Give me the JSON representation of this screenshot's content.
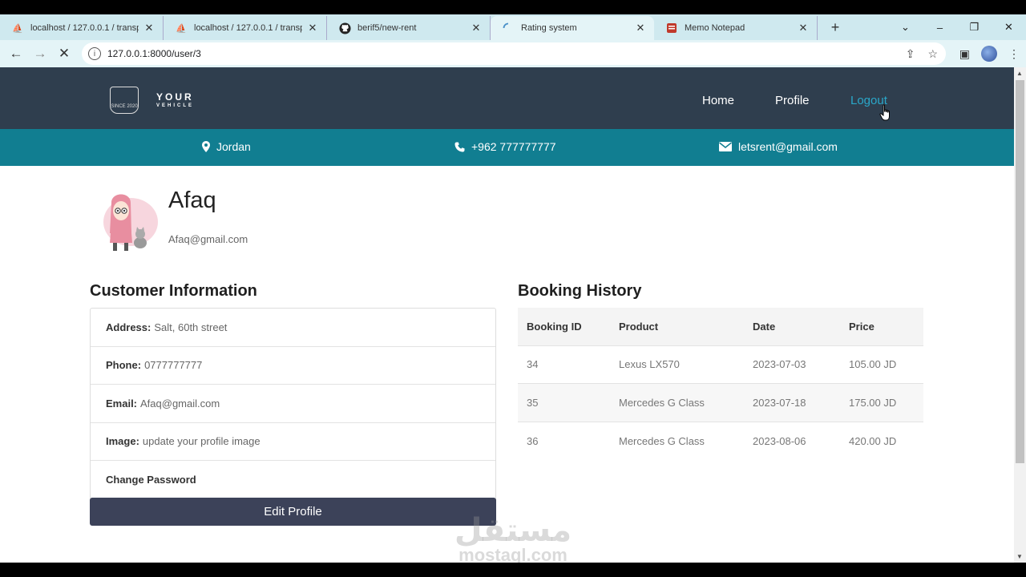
{
  "browser": {
    "tabs": [
      {
        "title": "localhost / 127.0.0.1 / transp",
        "icon": "pma-icon"
      },
      {
        "title": "localhost / 127.0.0.1 / transp",
        "icon": "pma-icon"
      },
      {
        "title": "berif5/new-rent",
        "icon": "github-icon"
      },
      {
        "title": "Rating system",
        "icon": "loading-spinner-icon"
      },
      {
        "title": "Memo Notepad",
        "icon": "memo-icon"
      }
    ],
    "active_tab_index": 3,
    "url": "127.0.0.1:8000/user/3",
    "new_tab_label": "+"
  },
  "site": {
    "logo": {
      "line1": "YOUR",
      "line2": "VEHICLE",
      "badge_text": "SINCE 2020"
    },
    "nav": {
      "home": "Home",
      "profile": "Profile",
      "logout": "Logout"
    },
    "contact": {
      "location": "Jordan",
      "phone": "+962 777777777",
      "email": "letsrent@gmail.com"
    }
  },
  "profile": {
    "name": "Afaq",
    "email": "Afaq@gmail.com"
  },
  "customer_info": {
    "title": "Customer Information",
    "rows": [
      {
        "label": "Address:",
        "value": "Salt, 60th street"
      },
      {
        "label": "Phone:",
        "value": "0777777777"
      },
      {
        "label": "Email:",
        "value": "Afaq@gmail.com"
      },
      {
        "label": "Image:",
        "value": "update your profile image"
      },
      {
        "label": "Change Password",
        "value": ""
      }
    ],
    "edit_button": "Edit Profile"
  },
  "booking_history": {
    "title": "Booking History",
    "columns": [
      "Booking ID",
      "Product",
      "Date",
      "Price"
    ],
    "rows": [
      [
        "34",
        "Lexus LX570",
        "2023-07-03",
        "105.00 JD"
      ],
      [
        "35",
        "Mercedes G Class",
        "2023-07-18",
        "175.00 JD"
      ],
      [
        "36",
        "Mercedes G Class",
        "2023-08-06",
        "420.00 JD"
      ]
    ]
  },
  "watermark": {
    "arabic": "مستقل",
    "latin": "mostaql.com"
  },
  "colors": {
    "header_bg": "#2f3e4e",
    "contact_bar_bg": "#117e91",
    "logout_link": "#2aa7c9",
    "edit_button_bg": "#3c4259",
    "tab_bar_bg": "#cfe9ef"
  }
}
